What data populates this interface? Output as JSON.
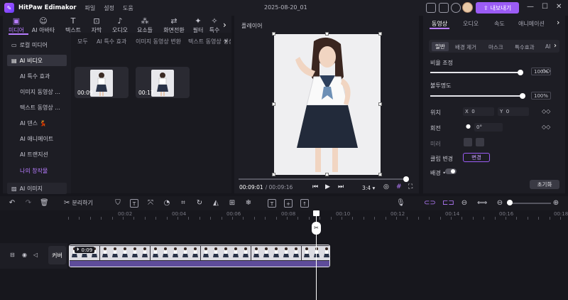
{
  "titlebar": {
    "app_name": "HitPaw Edimakor",
    "menus": [
      "파일",
      "설정",
      "도움"
    ],
    "window_title": "2025-08-20_01",
    "export_label": "내보내기"
  },
  "toolbar": {
    "tools": [
      {
        "label": "미디어",
        "icon": "media-icon",
        "glyph": "▣"
      },
      {
        "label": "AI 아바타",
        "icon": "avatar-icon",
        "glyph": "☺"
      },
      {
        "label": "텍스트",
        "icon": "text-icon",
        "glyph": "T"
      },
      {
        "label": "자막",
        "icon": "subtitle-icon",
        "glyph": "⊡"
      },
      {
        "label": "오디오",
        "icon": "audio-icon",
        "glyph": "♪"
      },
      {
        "label": "요소들",
        "icon": "elements-icon",
        "glyph": "⁂"
      },
      {
        "label": "화면전환",
        "icon": "transition-icon",
        "glyph": "⇄"
      },
      {
        "label": "필터",
        "icon": "filter-icon",
        "glyph": "✦"
      },
      {
        "label": "특수",
        "icon": "effects-icon",
        "glyph": "✧"
      }
    ]
  },
  "sidebar": {
    "items": [
      {
        "label": "로컬 미디어",
        "icon": "folder-icon"
      },
      {
        "label": "AI 비디오",
        "icon": "ai-video-icon"
      },
      {
        "label": "AI 특수 효과"
      },
      {
        "label": "이미지 동영상 ..."
      },
      {
        "label": "텍스트 동영상 ..."
      },
      {
        "label": "AI 댄스 💃"
      },
      {
        "label": "AI 애니메이트"
      },
      {
        "label": "AI 트랜지션"
      },
      {
        "label": "나의 창작물"
      },
      {
        "label": "AI 이미지",
        "icon": "ai-image-icon"
      }
    ]
  },
  "media": {
    "subtabs": [
      "모두",
      "AI 특수 효과",
      "이미지 동영상 변환",
      "텍스트 동영상 생성"
    ],
    "clips": [
      {
        "duration": "00:09"
      },
      {
        "duration": "00:17"
      }
    ]
  },
  "player": {
    "title": "플레이어",
    "current_time": "00:09:01",
    "total_time": "/ 00:09:16",
    "aspect": "3:4",
    "progress": 1.0
  },
  "properties": {
    "tabs": [
      "동영상",
      "오디오",
      "속도",
      "애니메이션"
    ],
    "subtabs": [
      "일반",
      "배경 제거",
      "마스크",
      "특수효과",
      "AI"
    ],
    "opacity": {
      "label": "비율 조정",
      "value": "100%",
      "level": 0.98
    },
    "transparency": {
      "label": "불투명도",
      "value": "100%",
      "level": 1.0
    },
    "position": {
      "label": "위치",
      "x_label": "X",
      "x": "0",
      "y_label": "Y",
      "y": "0"
    },
    "rotation": {
      "label": "회전",
      "value": "0°"
    },
    "mirror": {
      "label": "미러"
    },
    "clip_change": {
      "label": "클립 변경",
      "button": "변경"
    },
    "background": {
      "label": "배경 •"
    },
    "reset_label": "초기화"
  },
  "timeline": {
    "split_label": "분리하기",
    "ruler_labels": [
      "00:02",
      "00:04",
      "00:06",
      "00:08",
      "00:10",
      "00:12",
      "00:14",
      "00:16",
      "00:18"
    ],
    "track_label": "커버",
    "clip_duration": "0:09"
  },
  "colors": {
    "accent": "#9b5cf5",
    "panel": "#1d1d24",
    "background": "#16161c",
    "waveform": "#5e4c9a"
  }
}
